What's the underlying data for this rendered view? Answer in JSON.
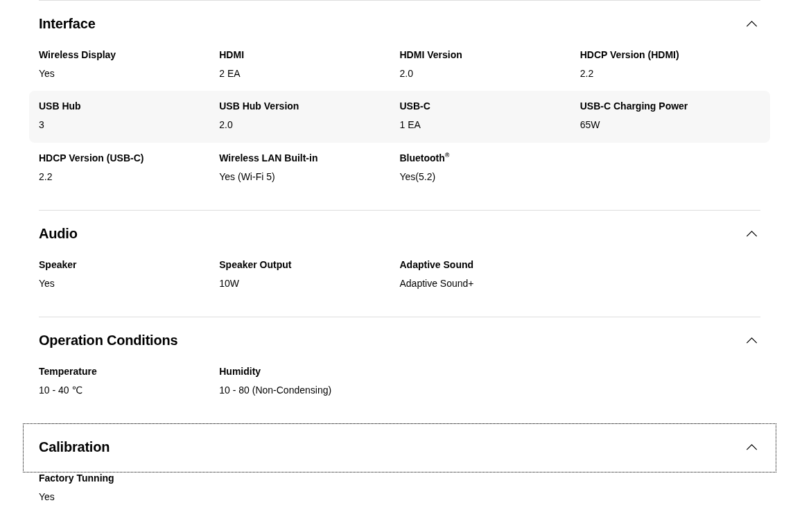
{
  "sections": [
    {
      "title": "Interface",
      "expanded": true,
      "focused": false,
      "rows": [
        {
          "highlighted": false,
          "specs": [
            {
              "label": "Wireless Display",
              "value": "Yes"
            },
            {
              "label": "HDMI",
              "value": "2 EA"
            },
            {
              "label": "HDMI Version",
              "value": "2.0"
            },
            {
              "label": "HDCP Version (HDMI)",
              "value": "2.2"
            }
          ]
        },
        {
          "highlighted": true,
          "specs": [
            {
              "label": "USB Hub",
              "value": "3"
            },
            {
              "label": "USB Hub Version",
              "value": "2.0"
            },
            {
              "label": "USB-C",
              "value": "1 EA"
            },
            {
              "label": "USB-C Charging Power",
              "value": "65W"
            }
          ]
        },
        {
          "highlighted": false,
          "specs": [
            {
              "label": "HDCP Version (USB-C)",
              "value": "2.2"
            },
            {
              "label": "Wireless LAN Built-in",
              "value": "Yes (Wi-Fi 5)"
            },
            {
              "label": "Bluetooth$^{®}$",
              "value": "Yes(5.2)"
            }
          ]
        }
      ]
    },
    {
      "title": "Audio",
      "expanded": true,
      "focused": false,
      "rows": [
        {
          "highlighted": false,
          "specs": [
            {
              "label": "Speaker",
              "value": "Yes"
            },
            {
              "label": "Speaker Output",
              "value": "10W"
            },
            {
              "label": "Adaptive Sound",
              "value": "Adaptive Sound+"
            }
          ]
        }
      ]
    },
    {
      "title": "Operation Conditions",
      "expanded": true,
      "focused": false,
      "rows": [
        {
          "highlighted": false,
          "specs": [
            {
              "label": "Temperature",
              "value": "10 - 40 ℃"
            },
            {
              "label": "Humidity",
              "value": "10 - 80 (Non-Condensing)"
            }
          ]
        }
      ]
    },
    {
      "title": "Calibration",
      "expanded": true,
      "focused": true,
      "rows": [
        {
          "highlighted": false,
          "specs": [
            {
              "label": "Factory Tunning",
              "value": "Yes"
            }
          ]
        }
      ]
    }
  ]
}
